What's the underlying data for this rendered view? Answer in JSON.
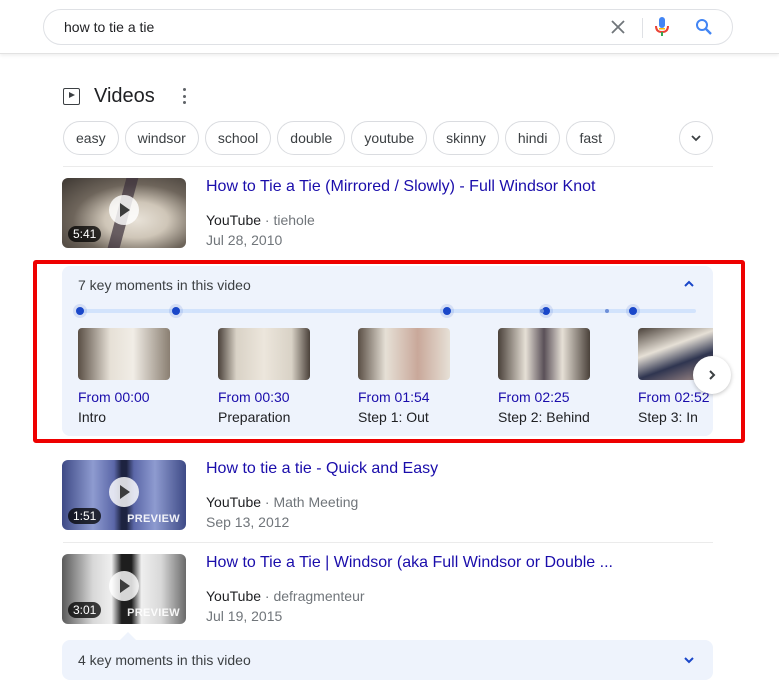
{
  "search": {
    "query": "how to tie a tie",
    "icons": [
      "close-icon",
      "microphone-icon",
      "search-icon"
    ]
  },
  "videos_section": {
    "title": "Videos",
    "chips": [
      "easy",
      "windsor",
      "school",
      "double",
      "youtube",
      "skinny",
      "hindi",
      "fast"
    ]
  },
  "results": [
    {
      "title": "How to Tie a Tie (Mirrored / Slowly) - Full Windsor Knot",
      "source": "YouTube",
      "channel": "tiehole",
      "date": "Jul 28, 2010",
      "duration": "5:41",
      "preview_label": "",
      "key_moments": {
        "label": "7 key moments in this video",
        "expanded": true,
        "timeline_positions_sec": [
          0,
          30,
          114,
          145,
          172
        ],
        "timeline_minor_fraction": [
          0.75,
          0.855
        ],
        "items": [
          {
            "from": "From 00:00",
            "name": "Intro"
          },
          {
            "from": "From 00:30",
            "name": "Preparation"
          },
          {
            "from": "From 01:54",
            "name": "Step 1: Out"
          },
          {
            "from": "From 02:25",
            "name": "Step 2: Behind"
          },
          {
            "from": "From 02:52",
            "name": "Step 3: In"
          }
        ]
      }
    },
    {
      "title": "How to tie a tie - Quick and Easy",
      "source": "YouTube",
      "channel": "Math Meeting",
      "date": "Sep 13, 2012",
      "duration": "1:51",
      "preview_label": "PREVIEW"
    },
    {
      "title": "How to Tie a Tie | Windsor (aka Full Windsor or Double ...",
      "source": "YouTube",
      "channel": "defragmenteur",
      "date": "Jul 19, 2015",
      "duration": "3:01",
      "preview_label": "PREVIEW",
      "key_moments": {
        "label": "4 key moments in this video",
        "expanded": false
      }
    }
  ],
  "colors": {
    "link": "#1a0dab",
    "highlight_outline": "#ee0000",
    "key_moments_bg": "#eef3fc",
    "timeline_dot": "#1a47c9"
  }
}
